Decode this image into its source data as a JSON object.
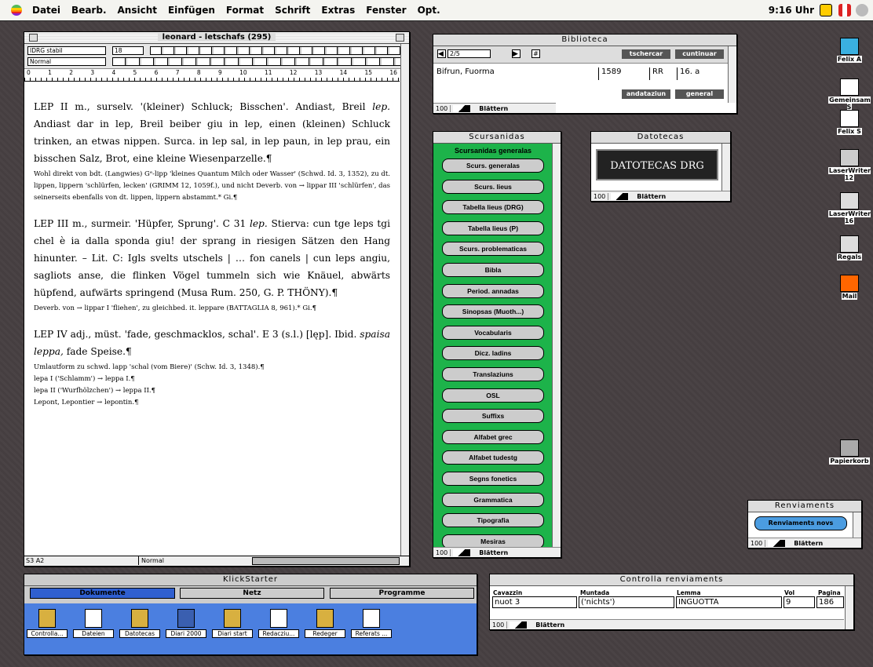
{
  "menubar": {
    "items": [
      "Datei",
      "Bearb.",
      "Ansicht",
      "Einfügen",
      "Format",
      "Schrift",
      "Extras",
      "Fenster",
      "Opt."
    ],
    "clock": "9:16 Uhr"
  },
  "doc_window": {
    "title": "leonard - letschafs (295)",
    "style": "IDRG stabil",
    "size": "18",
    "para": "Normal",
    "status_left": "S3 A2",
    "status_style": "Normal",
    "ruler": [
      "0",
      "1",
      "2",
      "3",
      "4",
      "5",
      "6",
      "7",
      "8",
      "9",
      "10",
      "11",
      "12",
      "13",
      "14",
      "15",
      "16"
    ],
    "content": [
      {
        "b": "LEP II m., surselv. '(kleiner) Schluck; Bisschen'. Andiast, Breil ",
        "i": "lep.",
        "c": " Andiast dar in lep, Breil beiber giu in lep, einen (kleinen) Schluck trinken, an etwas nippen. Surca. in lep sal, in lep paun, in lep prau, ein bisschen Salz, Brot, eine kleine Wiesenparzelle.¶"
      },
      {
        "s": "Wohl direkt von bdt. (Langwies) Gᵉ-lipp 'kleines Quantum Milch oder Wasser' (Schwd. Id. 3, 1352), zu dt. lippen, lippern 'schlürfen, lecken' (GRIMM 12, 1059f.), und nicht Deverb. von → lippar III 'schlürfen', das seinerseits ebenfalls von dt. lippen, lippern abstammt.*   Gi.¶"
      },
      {
        "b": "LEP III m., surmeir. 'Hüpfer, Sprung'. C 31 ",
        "i": "lep.",
        "c": " Stierva: cun tge leps tgi chel è ia dalla sponda giu! der sprang in riesigen Sätzen den Hang hinunter. – Lit. C: Igls svelts utschels | … fon canels | cun leps angiu, sagliots anse, die flinken Vögel tummeln sich wie Knäuel, abwärts hüpfend, aufwärts springend (Musa Rum. 250, G. P. THÖNY).¶"
      },
      {
        "s": "Deverb. von → lippar I 'fliehen', zu gleichbed. it. leppare (BATTAGLIA 8, 961).*   Gi.¶"
      },
      {
        "b": "LEP IV adj., müst. 'fade, geschmacklos, schal'. E 3 (s.l.) [lęp]. Ibid. ",
        "i": "spaisa leppa,",
        "c": " fade Speise.¶"
      },
      {
        "s2": "Umlautform zu schwd. lapp 'schal (vom Biere)' (Schw. Id. 3, 1348).¶"
      },
      {
        "s2": " "
      },
      {
        "s2": "lepa I ('Schlamm') → leppa I.¶"
      },
      {
        "s2": "lepa II ('Wurfhölzchen') → leppa II.¶"
      },
      {
        "s2": "Lepont, Lepontier → lepontin.¶"
      }
    ]
  },
  "biblioteca": {
    "title": "Biblioteca",
    "record": "2/5",
    "btn_search": "tschercar",
    "btn_cont": "cuntinuar",
    "btn_ord": "andataziun",
    "btn_gen": "general",
    "author": "Bifrun, Fuorma",
    "year": "1589",
    "code": "RR",
    "cent": "16. a",
    "zoom": "100",
    "mode": "Blättern"
  },
  "scursanidas": {
    "title": "Scursanidas",
    "heading": "Scursanidas generalas",
    "buttons": [
      "Scurs. generalas",
      "Scurs. lieus",
      "Tabella lieus (DRG)",
      "Tabella lieus (P)",
      "Scurs. problematicas",
      "Bibla",
      "Period. annadas",
      "Sinopsas (Muoth...)",
      "Vocabularis",
      "Dicz. ladins",
      "Translaziuns",
      "OSL",
      "Suffixs",
      "Alfabet grec",
      "Alfabet tudestg",
      "Segns fonetics",
      "Grammatica",
      "Tipografia",
      "Mesiras"
    ],
    "zoom": "100",
    "mode": "Blättern"
  },
  "datotecas": {
    "title": "Datotecas",
    "banner": "DATOTECAS DRG",
    "zoom": "100",
    "mode": "Blättern"
  },
  "renviaments": {
    "title": "Renviaments",
    "button": "Renviaments novs",
    "zoom": "100",
    "mode": "Blättern"
  },
  "controlla": {
    "title": "Controlla renviaments",
    "headers": [
      "Cavazzin",
      "Muntada",
      "Lemma",
      "Vol",
      "Pagina"
    ],
    "values": [
      "nuot 3",
      "('nichts')",
      "INGUOTTA",
      "9",
      "186"
    ],
    "zoom": "100",
    "mode": "Blättern"
  },
  "klickstarter": {
    "title": "KlickStarter",
    "tabs": [
      "Dokumente",
      "Netz",
      "Programme"
    ],
    "items": [
      "Controlla...",
      "Dateien",
      "Datotecas",
      "Diari 2000",
      "Diari start",
      "Redacziu...",
      "Redeger",
      "Referats ..."
    ]
  },
  "desktop_icons": [
    "Felix A",
    "Gemeinsam S",
    "Felix S",
    "LaserWriter 12",
    "LaserWriter 16",
    "Regals",
    "Mail",
    "Papierkorb"
  ],
  "colors": {
    "green": "#1db34a",
    "blue": "#4b7fe0",
    "desktop": "#4a4244"
  }
}
